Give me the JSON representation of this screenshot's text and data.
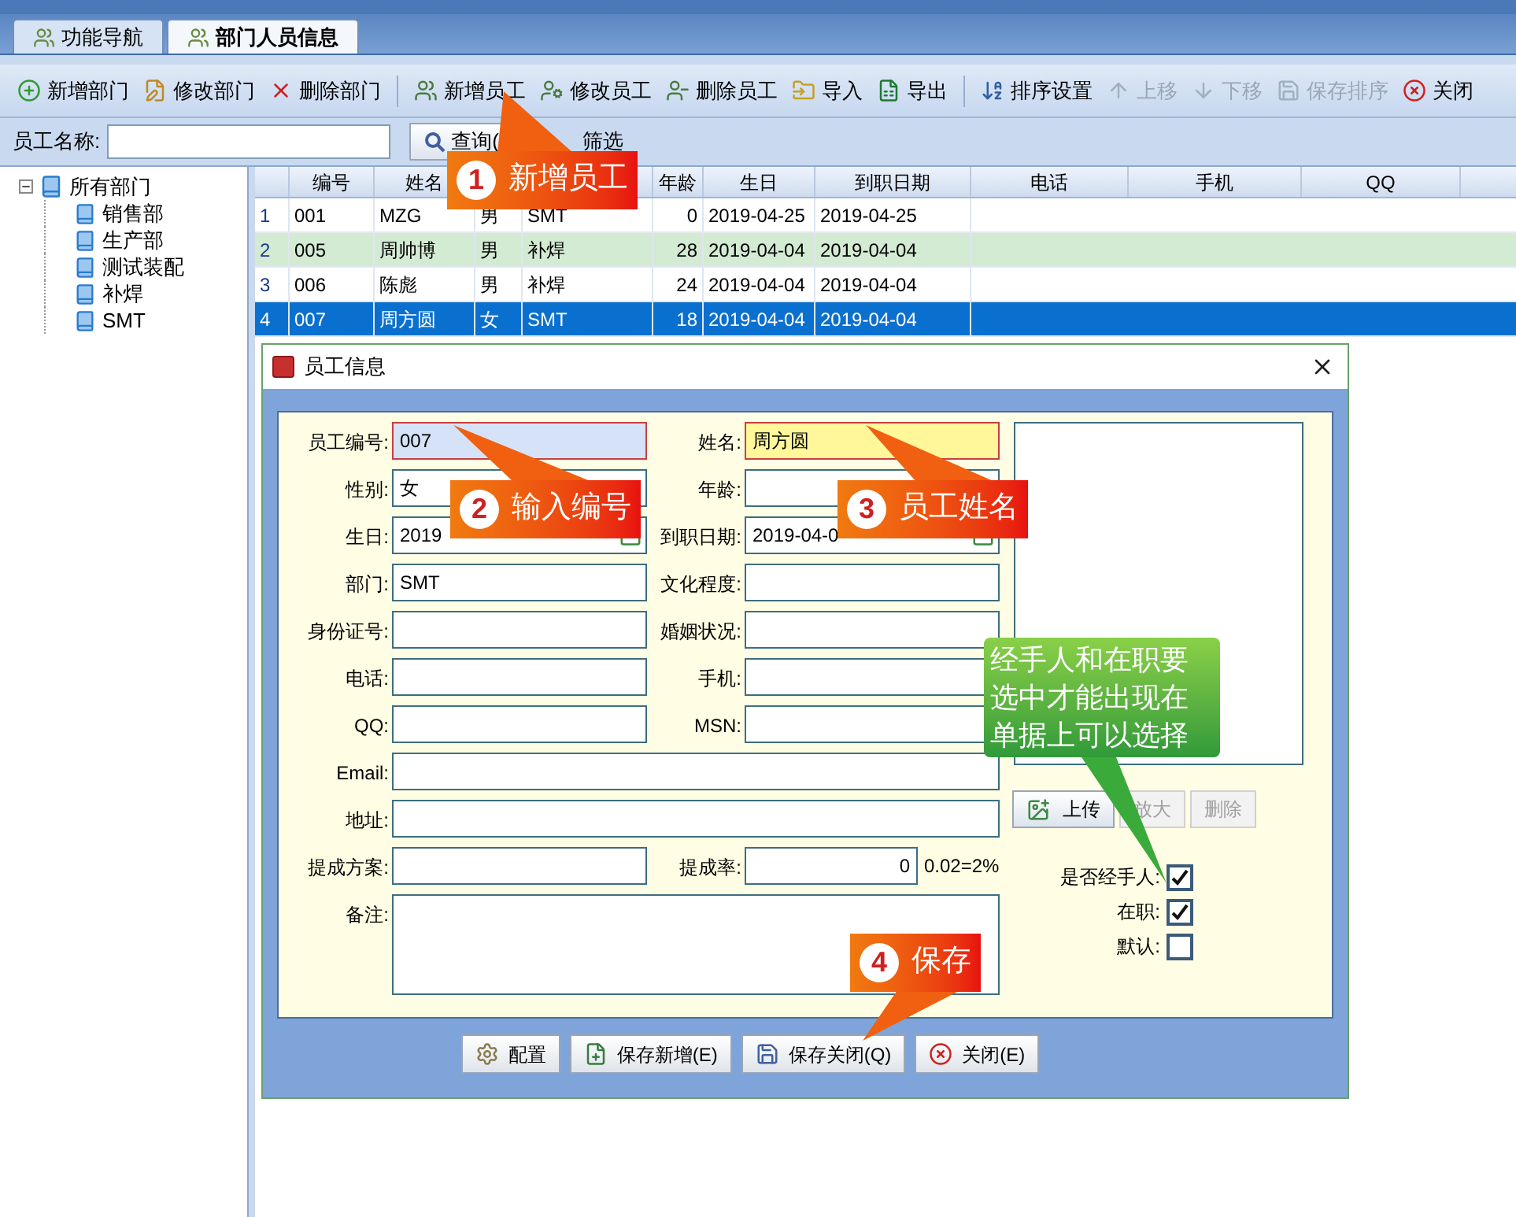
{
  "tabs": [
    {
      "label": "功能导航",
      "selected": false
    },
    {
      "label": "部门人员信息",
      "selected": true
    }
  ],
  "toolbar": [
    {
      "label": "新增部门",
      "disabled": false
    },
    {
      "label": "修改部门",
      "disabled": false
    },
    {
      "label": "删除部门",
      "disabled": false
    },
    {
      "label": "新增员工",
      "disabled": false
    },
    {
      "label": "修改员工",
      "disabled": false
    },
    {
      "label": "删除员工",
      "disabled": false
    },
    {
      "label": "导入",
      "disabled": false
    },
    {
      "label": "导出",
      "disabled": false
    },
    {
      "label": "排序设置",
      "disabled": false
    },
    {
      "label": "上移",
      "disabled": true
    },
    {
      "label": "下移",
      "disabled": true
    },
    {
      "label": "保存排序",
      "disabled": true
    },
    {
      "label": "关闭",
      "disabled": false
    }
  ],
  "search": {
    "label": "员工名称:",
    "button": "查询(",
    "filter": "筛选"
  },
  "tree": {
    "label": "所有部门",
    "expanded": true,
    "children": [
      {
        "label": "销售部"
      },
      {
        "label": "生产部"
      },
      {
        "label": "测试装配"
      },
      {
        "label": "补焊"
      },
      {
        "label": "SMT"
      }
    ]
  },
  "table": {
    "columns": [
      "",
      "编号",
      "姓名",
      "",
      "",
      "年龄",
      "生日",
      "到职日期",
      "电话",
      "手机",
      "QQ"
    ],
    "rows": [
      {
        "cells": [
          "1",
          "001",
          "MZG",
          "男",
          "SMT",
          "0",
          "2019-04-25",
          "2019-04-25"
        ],
        "selected": false
      },
      {
        "cells": [
          "2",
          "005",
          "周帅博",
          "男",
          "补焊",
          "28",
          "2019-04-04",
          "2019-04-04"
        ],
        "selected": false
      },
      {
        "cells": [
          "3",
          "006",
          "陈彪",
          "男",
          "补焊",
          "24",
          "2019-04-04",
          "2019-04-04"
        ],
        "selected": false
      },
      {
        "cells": [
          "4",
          "007",
          "周方圆",
          "女",
          "SMT",
          "18",
          "2019-04-04",
          "2019-04-04"
        ],
        "selected": true
      }
    ]
  },
  "dialog": {
    "title": "员工信息",
    "rows": [
      [
        {
          "label": "员工编号:",
          "value": "007",
          "kind": "text",
          "color": "#d6e2f8"
        },
        {
          "label": "姓名:",
          "value": "周方圆",
          "kind": "text",
          "color": "#fff79a"
        }
      ],
      [
        {
          "label": "性别:",
          "value": "女",
          "kind": "text"
        },
        {
          "label": "年龄:",
          "kind": "number"
        }
      ],
      [
        {
          "label": "生日:",
          "value": "2019",
          "kind": "date"
        },
        {
          "label": "到职日期:",
          "value": "2019-04-0",
          "kind": "date"
        }
      ],
      [
        {
          "label": "部门:",
          "value": "SMT",
          "kind": "text"
        },
        {
          "label": "文化程度:",
          "kind": "text"
        }
      ],
      [
        {
          "label": "身份证号:",
          "kind": "text"
        },
        {
          "label": "婚姻状况:",
          "kind": "text"
        }
      ],
      [
        {
          "label": "电话:",
          "kind": "text"
        },
        {
          "label": "手机:",
          "kind": "text"
        }
      ],
      [
        {
          "label": "QQ:",
          "kind": "text"
        },
        {
          "label": "MSN:",
          "kind": "text"
        }
      ],
      [
        {
          "label": "Email:",
          "kind": "wide"
        }
      ],
      [
        {
          "label": "地址:",
          "kind": "wide"
        }
      ],
      [
        {
          "label": "提成方案:",
          "kind": "text"
        },
        {
          "label": "提成率:",
          "value": "0",
          "kind": "number",
          "hint": "0.02=2%"
        }
      ],
      [
        {
          "label": "备注:",
          "kind": "textarea"
        }
      ]
    ],
    "photo_buttons": [
      {
        "label": "上传",
        "disabled": false
      },
      {
        "label": "放大",
        "disabled": true
      },
      {
        "label": "删除",
        "disabled": true
      }
    ],
    "checks": [
      {
        "label": "是否经手人:",
        "checked": true
      },
      {
        "label": "在职:",
        "checked": true
      },
      {
        "label": "默认:",
        "checked": false
      }
    ],
    "buttons": [
      "配置",
      "保存新增(E)",
      "保存关闭(Q)",
      "关闭(E)"
    ]
  },
  "annotations": [
    {
      "number": "1",
      "text": "新增员工",
      "kind": "step"
    },
    {
      "number": "2",
      "text": "输入编号",
      "kind": "step"
    },
    {
      "number": "3",
      "text": "员工姓名",
      "kind": "step"
    },
    {
      "text": "经手人和在职要选中才能出现在单据上可以选择",
      "kind": "note"
    },
    {
      "number": "4",
      "text": "保存",
      "kind": "step"
    }
  ]
}
